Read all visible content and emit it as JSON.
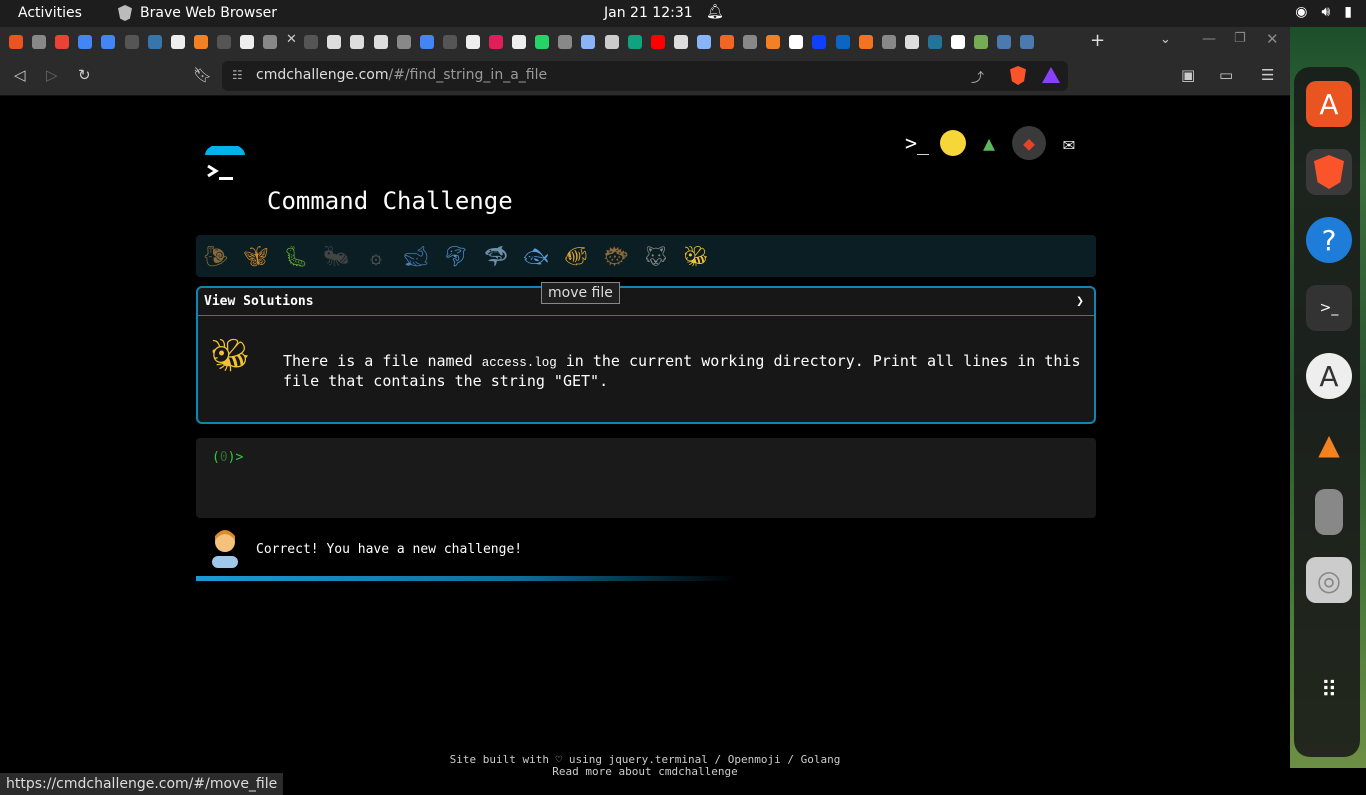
{
  "system": {
    "activities": "Activities",
    "app_name": "Brave Web Browser",
    "date_time": "Jan 21  12:31"
  },
  "browser": {
    "url_domain": "cmdchallenge.com",
    "url_path": "/#/find_string_in_a_file",
    "status_url": "https://cmdchallenge.com/#/move_file",
    "tab_favicons": [
      "ubuntu-icon",
      "globe-icon",
      "gmail-icon",
      "google-icon",
      "google-icon",
      "alt-icon",
      "python-icon",
      "wikipedia-icon",
      "stackoverflow-icon",
      "alt-icon",
      "wikipedia-icon",
      "globe-icon",
      "alt-icon",
      "github-icon",
      "github-icon",
      "github-icon",
      "globe-icon",
      "google-icon",
      "alt-icon",
      "cube-icon",
      "slack-icon",
      "wikipedia-icon",
      "whatsapp-icon",
      "globe-icon",
      "gemini-icon",
      "openai-icon",
      "chatgpt-icon",
      "youtube-icon",
      "museum-icon",
      "gemini-icon",
      "ls-icon",
      "globe-icon",
      "stackoverflow-icon",
      "x-icon",
      "bi-icon",
      "linkedin-icon",
      "hd-icon",
      "globe-icon",
      "github-icon",
      "wordpress-icon",
      "h-icon",
      "bottle-icon",
      "cap-icon",
      "cap-icon"
    ]
  },
  "page": {
    "title": "Command Challenge",
    "tooltip": "move file",
    "view_solutions": "View Solutions",
    "challenge_pre": "There is a file named ",
    "challenge_code": "access.log",
    "challenge_post": " in the current working directory. Print all lines in this file that contains the string \"GET\".",
    "prompt_open": "(",
    "prompt_count": "0",
    "prompt_close": ")>",
    "feedback": "Correct! You have a new challenge!",
    "footer_line1": "Site built with ♡ using jquery.terminal / Openmoji / Golang",
    "footer_line2": "Read more about cmdchallenge",
    "animals": [
      "snail",
      "butterfly",
      "caterpillar",
      "ant",
      "spiral",
      "whale",
      "dolphin",
      "shark",
      "fish",
      "tropical-fish",
      "blowfish",
      "wolf",
      "bee"
    ],
    "social": [
      "terminal",
      "thinking-face",
      "tree",
      "gitlab",
      "mail"
    ]
  },
  "colors": {
    "accent": "#0e86b3",
    "prompt": "#2ecc40",
    "brave": "#fb542b"
  },
  "progress": 0.42
}
